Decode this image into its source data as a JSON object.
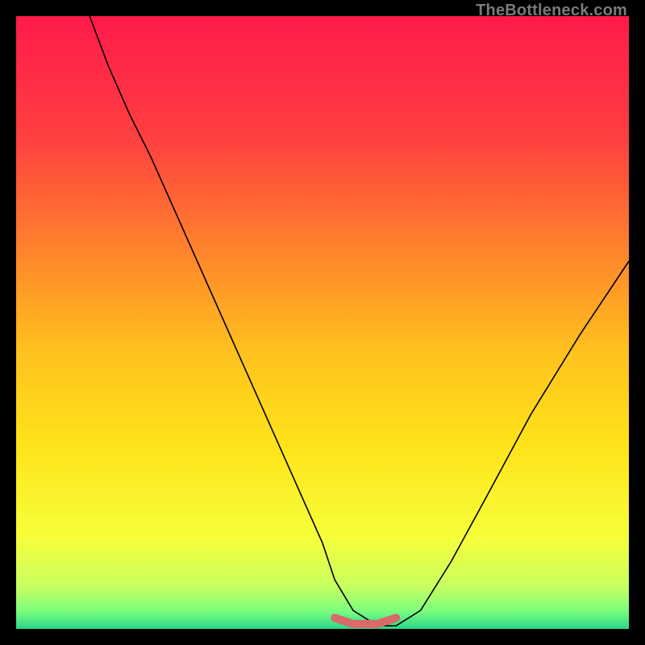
{
  "watermark": "TheBottleneck.com",
  "chart_data": {
    "type": "line",
    "title": "",
    "xlabel": "",
    "ylabel": "",
    "xlim": [
      0,
      100
    ],
    "ylim": [
      0,
      100
    ],
    "grid": false,
    "legend": false,
    "background_gradient": {
      "stops": [
        {
          "offset": 0.0,
          "color": "#ff1a4b"
        },
        {
          "offset": 0.2,
          "color": "#ff4040"
        },
        {
          "offset": 0.4,
          "color": "#ff8a2a"
        },
        {
          "offset": 0.55,
          "color": "#ffc21e"
        },
        {
          "offset": 0.7,
          "color": "#ffe31a"
        },
        {
          "offset": 0.85,
          "color": "#f6ff3a"
        },
        {
          "offset": 0.93,
          "color": "#c8ff60"
        },
        {
          "offset": 0.97,
          "color": "#7dff7d"
        },
        {
          "offset": 1.0,
          "color": "#2bd68a"
        }
      ]
    },
    "series": [
      {
        "name": "bottleneck-curve",
        "color": "#000000",
        "stroke_width": 1.6,
        "x": [
          12,
          15,
          18.5,
          22,
          26,
          30,
          34,
          38,
          42,
          46,
          50,
          52,
          55,
          59,
          62,
          66,
          71,
          77,
          84,
          92,
          100
        ],
        "values": [
          100,
          92,
          84,
          77,
          68,
          59,
          50,
          41,
          32,
          23,
          14,
          8,
          3,
          0.5,
          0.5,
          3,
          11,
          22,
          35,
          48,
          60
        ]
      },
      {
        "name": "optimal-range-highlight",
        "color": "#d86a6a",
        "stroke_width": 10,
        "linecap": "round",
        "x": [
          52,
          55,
          59,
          62
        ],
        "values": [
          1.8,
          0.8,
          0.8,
          1.8
        ]
      }
    ],
    "annotations": []
  }
}
